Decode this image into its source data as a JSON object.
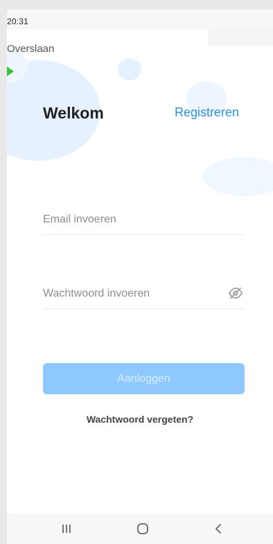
{
  "status_bar": {
    "time": "20:31"
  },
  "header": {
    "skip_label": "Overslaan"
  },
  "auth": {
    "title": "Welkom",
    "register_label": "Registreren",
    "email_placeholder": "Email invoeren",
    "password_placeholder": "Wachtwoord invoeren",
    "login_label": "Aanloggen",
    "forgot_password_label": "Wachtwoord vergeten?"
  },
  "icons": {
    "password_visibility": "eye-slash-icon",
    "recents": "recent-apps-icon",
    "home": "home-icon",
    "back": "back-icon"
  },
  "colors": {
    "accent_link": "#3090db",
    "login_button": "#8ec8ff",
    "background_bubbles": "#e6f1ff"
  }
}
